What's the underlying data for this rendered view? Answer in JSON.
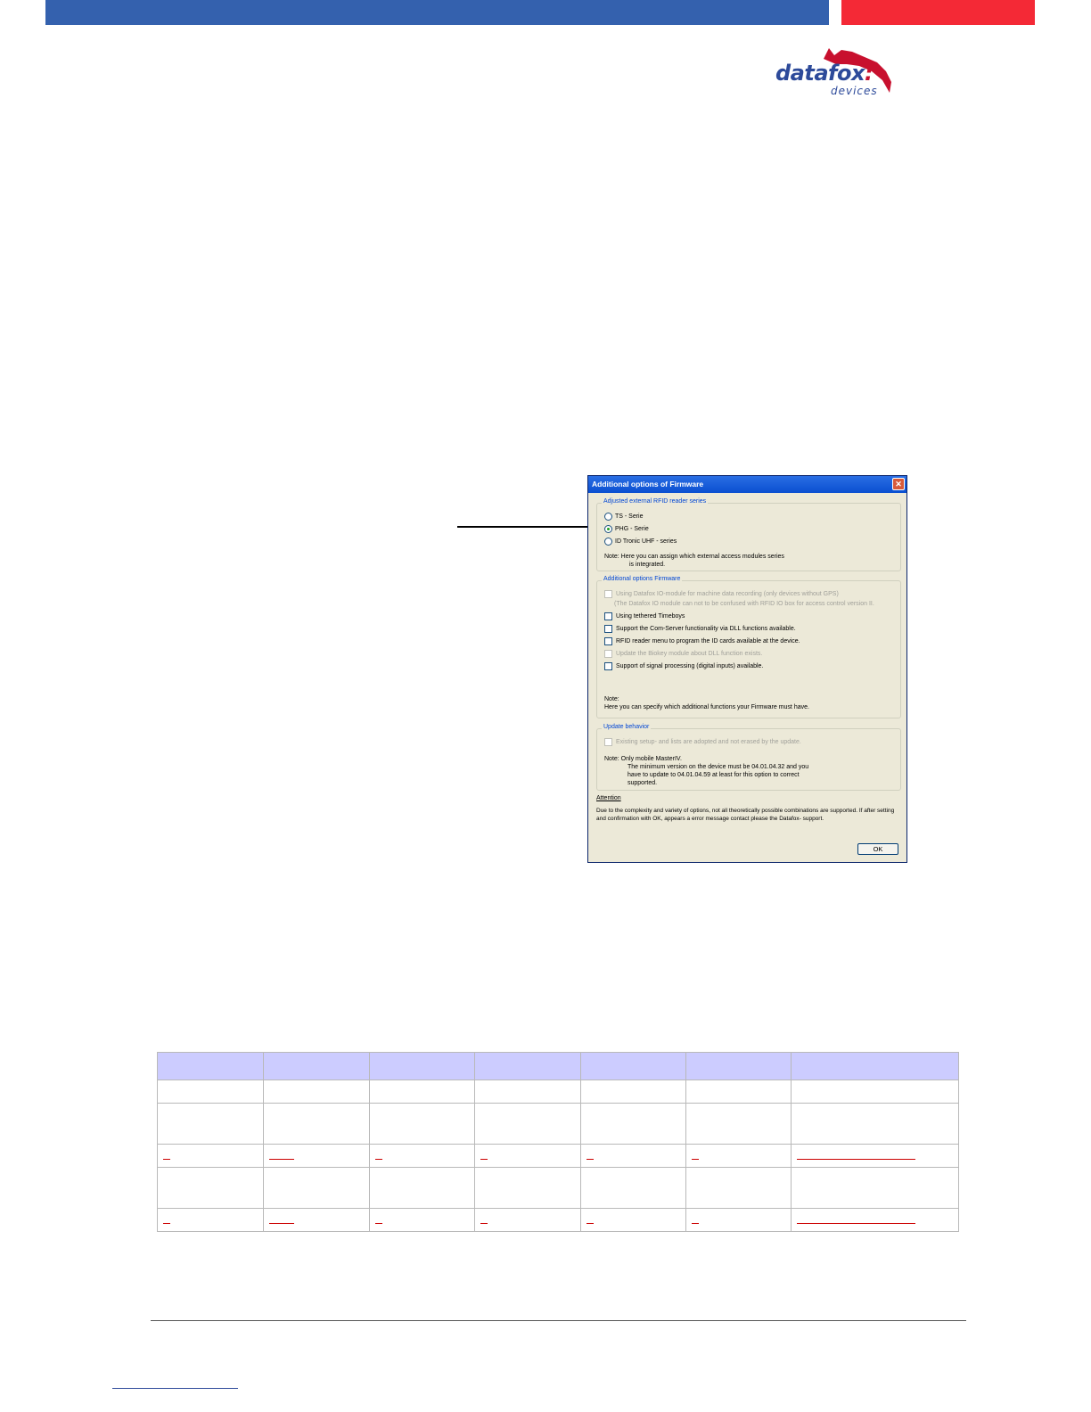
{
  "brand": {
    "logo_word_main": "datafox",
    "logo_word_accent": ":",
    "logo_sub": "devices"
  },
  "dialog": {
    "title": "Additional options of Firmware",
    "close_glyph": "✕",
    "reader_group": {
      "title": "Adjusted external RFID reader series",
      "options": [
        "TS - Serie",
        "PHG - Serie",
        "ID Tronic UHF - series"
      ],
      "selected": "PHG - Serie",
      "note_line1": "Note: Here you can assign which external access modules series",
      "note_line2": "is integrated."
    },
    "options_group": {
      "title": "Additional options Firmware",
      "item1": "Using Datafox IO-module for machine data recording (only devices without GPS)",
      "item1_sub": "(The Datafox IO module can not to be confused with RFID IO box for access control version II.",
      "item2": "Using tethered Timeboys",
      "item3": "Support the Com-Server functionality via DLL functions available.",
      "item4": "RFID reader menu to program the ID cards available at the device.",
      "item5": "Update the Biokey module about DLL function exists.",
      "item6": "Support of signal processing (digital inputs) available.",
      "note_label": "Note:",
      "note_text": "Here you can specify which additional functions your Firmware must have."
    },
    "update_group": {
      "title": "Update behavior",
      "item1": "Existing setup- and lists are adopted and not erased by the update.",
      "note_line1": "Note: Only mobile MasterIV.",
      "note_line2": "The minimum version on the device must be 04.01.04.32 and you",
      "note_line3": "have to update to 04.01.04.59 at least for this option to correct",
      "note_line4": "supported."
    },
    "attention_title": "Attention",
    "attention_text": "Due to the complexity and variety of options, not all theoretically possible combinations are supported. If after setting and confirmation with OK, appears a error message contact please the Datafox- support.",
    "ok_label": "OK"
  },
  "colors": {
    "header_blue": "#3461ae",
    "header_red": "#f42936",
    "table_header": "#ccccff",
    "link_red": "#cc0000"
  }
}
